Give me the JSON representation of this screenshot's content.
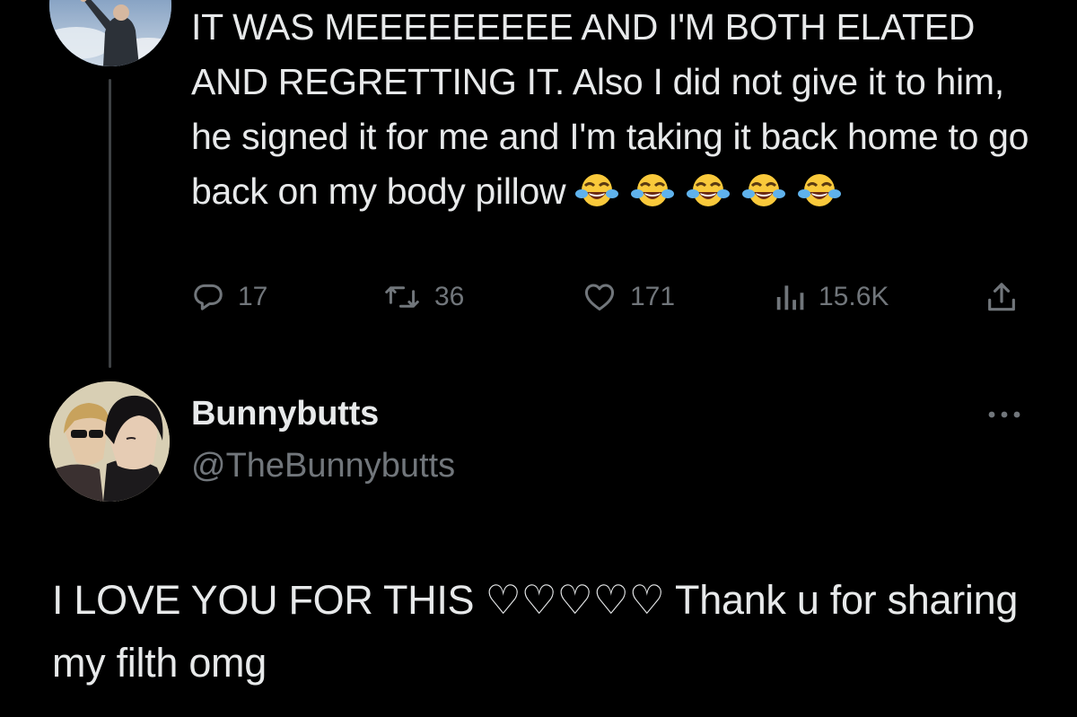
{
  "first_tweet": {
    "text": "IT WAS MEEEEEEEEE AND I'M BOTH ELATED AND REGRETTING IT. Also I did not give it to him, he signed it for me and I'm taking it back home to go back on my body pillow",
    "emoji": [
      "face-with-tears-of-joy",
      "face-with-tears-of-joy",
      "face-with-tears-of-joy",
      "face-with-tears-of-joy",
      "face-with-tears-of-joy"
    ],
    "stats": {
      "replies": "17",
      "retweets": "36",
      "likes": "171",
      "views": "15.6K"
    },
    "icons": {
      "reply": "reply-icon",
      "retweet": "retweet-icon",
      "like": "heart-icon",
      "views": "views-icon",
      "share": "share-icon"
    }
  },
  "reply": {
    "display_name": "Bunnybutts",
    "handle": "@TheBunnybutts",
    "text": "I LOVE YOU FOR THIS ♡♡♡♡♡ Thank u for sharing my filth omg"
  },
  "colors": {
    "background": "#000000",
    "text": "#e7e9ea",
    "muted": "#71767b",
    "thread_line": "#3e4144"
  }
}
